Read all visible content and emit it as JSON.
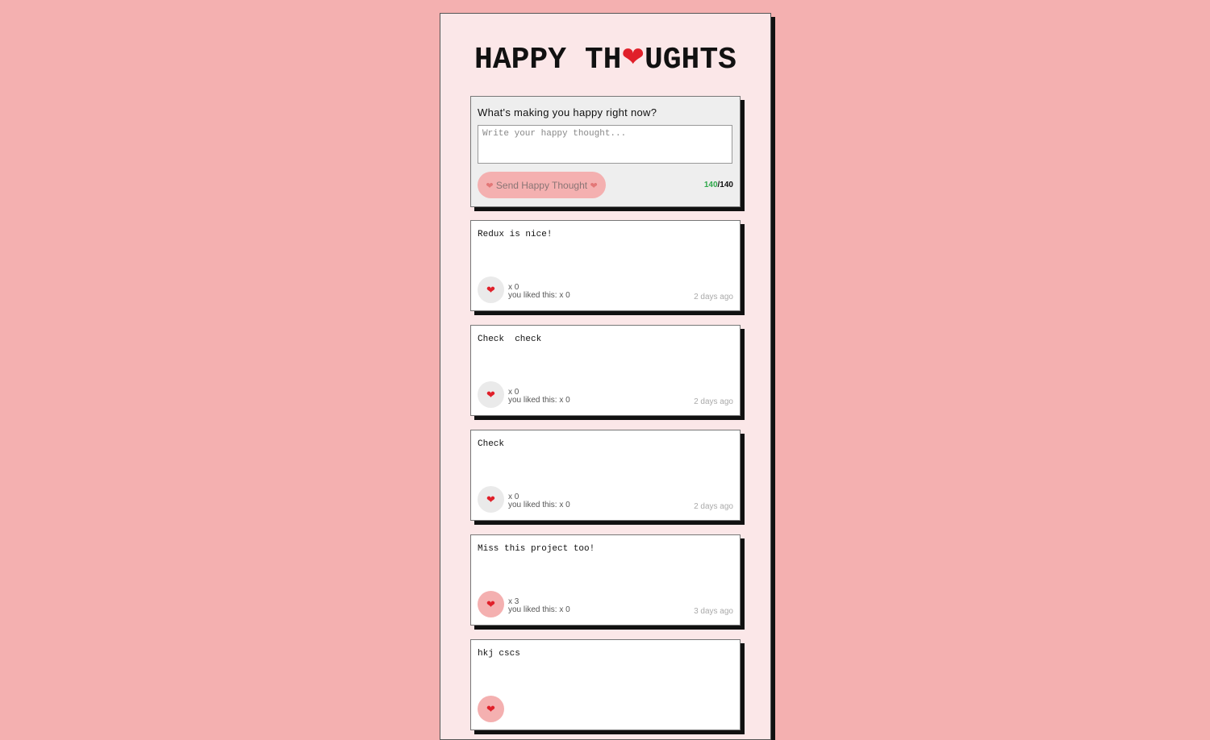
{
  "header": {
    "title_left": "HAPPY TH",
    "title_heart": "❤",
    "title_right": "UGHTS"
  },
  "form": {
    "question": "What's making you happy right now?",
    "placeholder": "Write your happy thought...",
    "value": "",
    "button_heart": "❤",
    "button_label": "Send Happy Thought",
    "chars_left": "140",
    "chars_max": "/140"
  },
  "thoughts": [
    {
      "message": "Redux is nice!",
      "hearts": "x 0",
      "you_liked": "you liked this: x 0",
      "time": "2 days ago",
      "heart": "❤"
    },
    {
      "message": "Check  check",
      "hearts": "x 0",
      "you_liked": "you liked this: x 0",
      "time": "2 days ago",
      "heart": "❤"
    },
    {
      "message": "Check",
      "hearts": "x 0",
      "you_liked": "you liked this: x 0",
      "time": "2 days ago",
      "heart": "❤"
    },
    {
      "message": "Miss this project too!",
      "hearts": "x 3",
      "you_liked": "you liked this: x 0",
      "time": "3 days ago",
      "heart": "❤"
    },
    {
      "message": "hkj cscs",
      "hearts": "",
      "you_liked": "",
      "time": "",
      "heart": "❤"
    }
  ],
  "colors": {
    "background": "#f4b0b0",
    "panel": "#fbe7e8",
    "liked_button": "#f4b0b0",
    "unliked_button": "#eaeaea",
    "heart": "#e0202a",
    "chars_left": "#2ea84a"
  }
}
